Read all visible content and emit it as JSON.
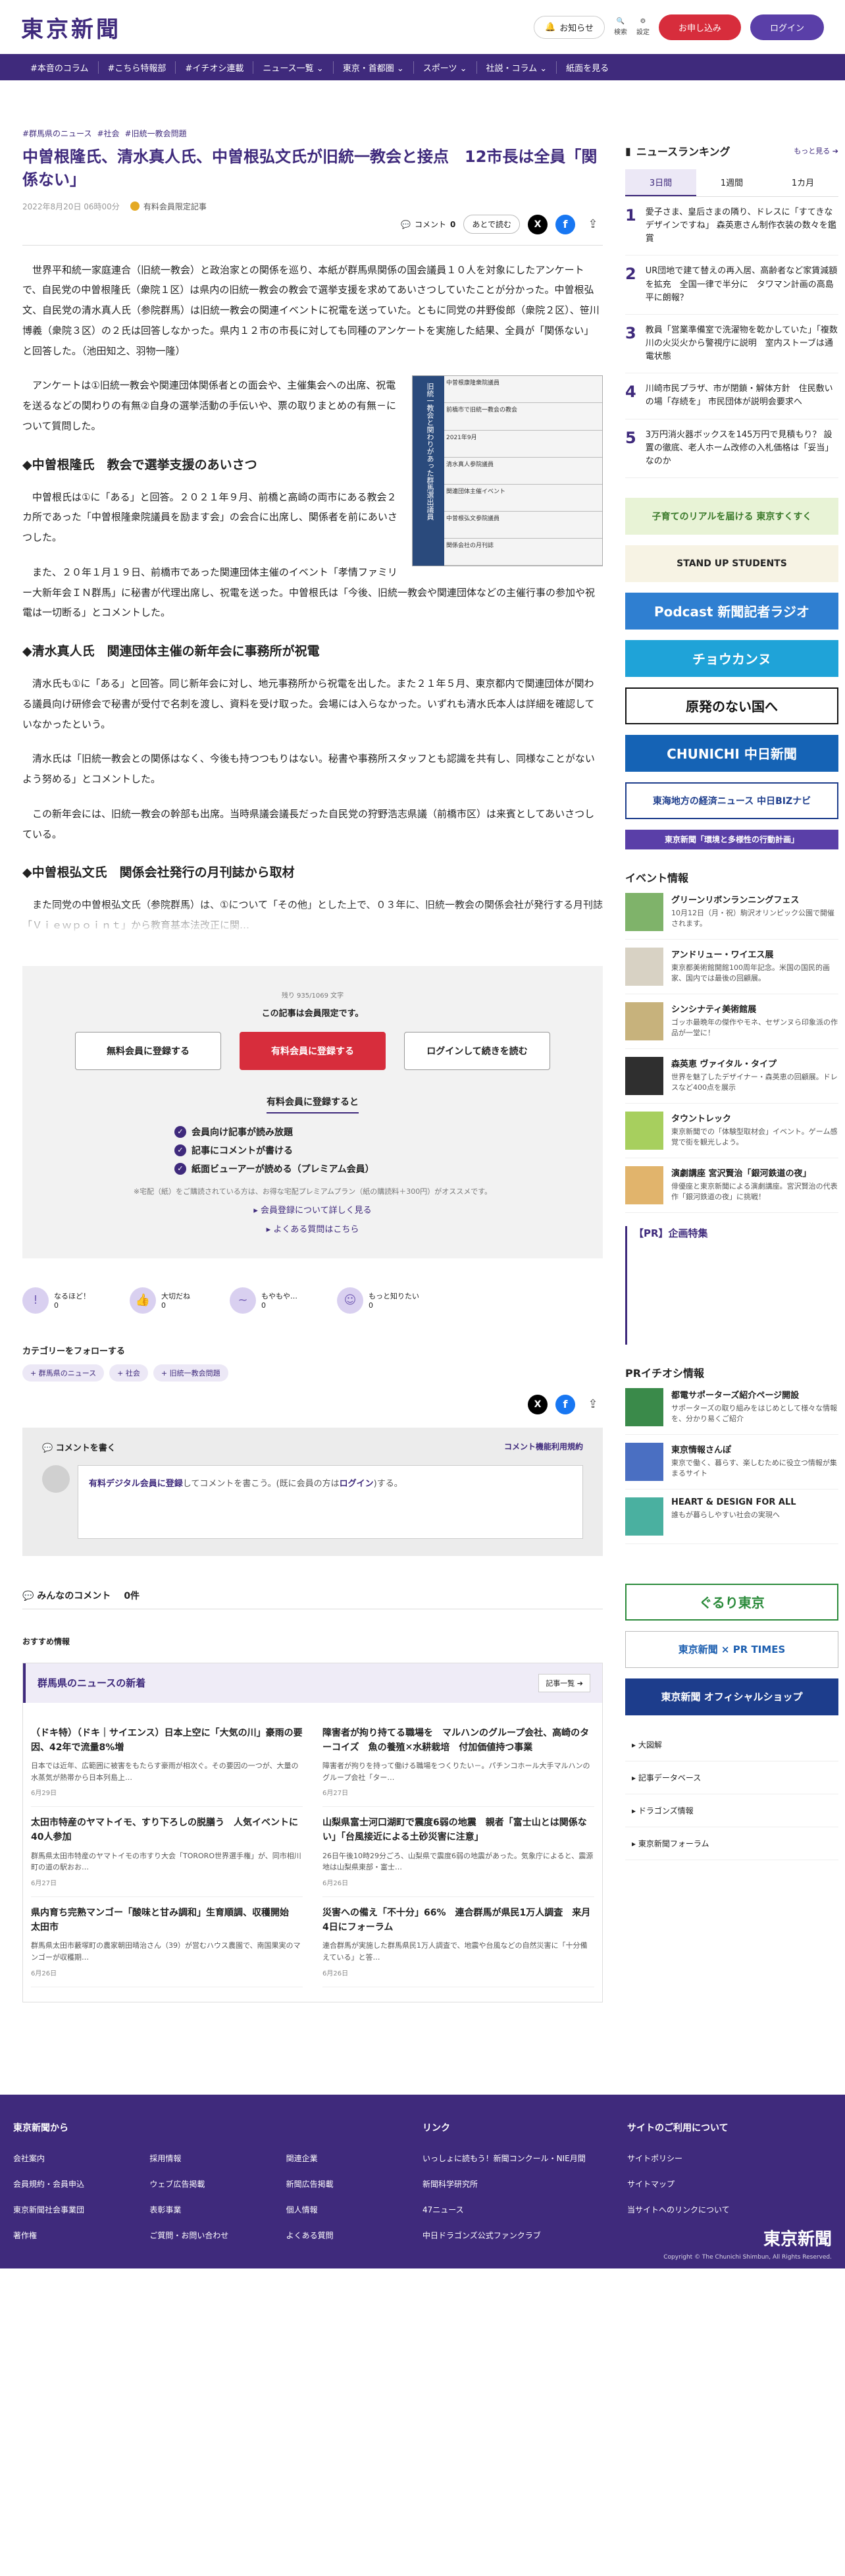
{
  "header": {
    "logo": "東京新聞",
    "notify": "お知らせ",
    "search": "検索",
    "settings": "設定",
    "register": "お申し込み",
    "login": "ログイン"
  },
  "nav": [
    "#本音のコラム",
    "#こちら特報部",
    "#イチオシ連載",
    "ニュース一覧 ⌄",
    "東京・首都圏 ⌄",
    "スポーツ ⌄",
    "社説・コラム ⌄",
    "紙面を見る"
  ],
  "article": {
    "tags": [
      "#群馬県のニュース",
      "#社会",
      "#旧統一教会問題"
    ],
    "title": "中曽根隆氏、清水真人氏、中曽根弘文氏が旧統一教会と接点　12市長は全員「関係ない」",
    "date": "2022年8月20日 06時00分",
    "limited": "有料会員限定記事",
    "comment_label": "コメント",
    "comment_count": "0",
    "later": "あとで読む",
    "paragraphs": [
      "世界平和統一家庭連合（旧統一教会）と政治家との関係を巡り、本紙が群馬県関係の国会議員１０人を対象にしたアンケートで、自民党の中曽根隆氏（衆院１区）は県内の旧統一教会の教会で選挙支援を求めてあいさつしていたことが分かった。中曽根弘文、自民党の清水真人氏（参院群馬）は旧統一教会の関連イベントに祝電を送っていた。ともに同党の井野俊郎（衆院２区）、笹川博義（衆院３区）の２氏は回答しなかった。県内１２市の市長に対しても同種のアンケートを実施した結果、全員が「関係ない」と回答した。（池田知之、羽物一隆）",
      "アンケートは①旧統一教会や関連団体関係者との面会や、主催集会への出席、祝電を送るなどの関わりの有無②自身の選挙活動の手伝いや、票の取りまとめの有無－について質問した。"
    ],
    "h1": "◆中曽根隆氏　教会で選挙支援のあいさつ",
    "p2": [
      "中曽根氏は①に「ある」と回答。２０２１年９月、前橋と高崎の両市にある教会２カ所であった「中曽根隆衆院議員を励ます会」の会合に出席し、関係者を前にあいさつした。",
      "また、２０年１月１９日、前橋市であった関連団体主催のイベント「孝情ファミリー大新年会ＩＮ群馬」に秘書が代理出席し、祝電を送った。中曽根氏は「今後、旧統一教会や関連団体などの主催行事の参加や祝電は一切断る」とコメントした。"
    ],
    "h2": "◆清水真人氏　関連団体主催の新年会に事務所が祝電",
    "p3": [
      "清水氏も①に「ある」と回答。同じ新年会に対し、地元事務所から祝電を出した。また２１年５月、東京都内で関連団体が関わる議員向け研修会で秘書が受付で名刺を渡し、資料を受け取った。会場には入らなかった。いずれも清水氏本人は詳細を確認していなかったという。",
      "清水氏は「旧統一教会との関係はなく、今後も持つつもりはない。秘書や事務所スタッフとも認識を共有し、同様なことがないよう努める」とコメントした。",
      "この新年会には、旧統一教会の幹部も出席。当時県議会議長だった自民党の狩野浩志県議（前橋市区）は来賓としてあいさつしている。"
    ],
    "h3": "◆中曽根弘文氏　関係会社発行の月刊誌から取材",
    "p4": "また同党の中曽根弘文氏（参院群馬）は、①について「その他」とした上で、０３年に、旧統一教会の関係会社が発行する月刊誌「Ｖｉｅｗｐｏｉｎｔ」から教育基本法改正に関…",
    "fig_caption": "旧統一教会と関わりがあった群馬選出議員",
    "fig_rows": [
      "中曽根康隆衆院議員",
      "前橋市で旧統一教会の教会",
      "2021年9月",
      "清水真人参院議員",
      "関連団体主催イベント",
      "中曽根弘文参院議員",
      "関係会社の月刊誌"
    ]
  },
  "paywall": {
    "remaining": "残り 935/1069 文字",
    "lead": "この記事は会員限定です。",
    "free": "無料会員に登録する",
    "paid": "有料会員に登録する",
    "login": "ログインして続きを読む",
    "reg_title": "有料会員に登録すると",
    "benefits": [
      "会員向け記事が読み放題",
      "記事にコメントが書ける",
      "紙面ビューアーが読める（プレミアム会員）"
    ],
    "note": "※宅配（紙）をご購読されている方は、お得な宅配プレミアムプラン（紙の購読料＋300円）がオススメです。",
    "more1": "会員登録について詳しく見る",
    "more2": "よくある質問はこちら"
  },
  "reactions": [
    {
      "label": "なるほど！",
      "n": "0"
    },
    {
      "label": "大切だね",
      "n": "0"
    },
    {
      "label": "もやもや…",
      "n": "0"
    },
    {
      "label": "もっと知りたい",
      "n": "0"
    }
  ],
  "follow": {
    "title": "カテゴリーをフォローする",
    "cats": [
      "+ 群馬県のニュース",
      "+ 社会",
      "+ 旧統一教会問題"
    ]
  },
  "comments": {
    "title": "コメントを書く",
    "rules": "コメント機能利用規約",
    "pre": "有料デジタル会員に登録",
    "mid": "してコメントを書こう。(既に会員の方は",
    "login": "ログイン",
    "post": ")する。",
    "all": "みんなのコメント",
    "count": "0件"
  },
  "recommend": "おすすめ情報",
  "local": {
    "title": "群馬県のニュースの新着",
    "more": "記事一覧 ➔",
    "items": [
      {
        "h": "（ドキ特）（ドキ｜サイエンス）日本上空に「大気の川」豪雨の要因、42年で流量8%増",
        "p": "日本では近年、広範囲に被害をもたらす豪雨が相次ぐ。その要因の一つが、大量の水蒸気が熱帯から日本列島上…",
        "t": "6月29日"
      },
      {
        "h": "障害者が拘り持てる職場を　マルハンのグループ会社、高崎のターコイズ　魚の養殖✕水耕栽培　付加価値持つ事業",
        "p": "障害者が拘りを持って働ける職場をつくりたい－。パチンコホール大手マルハンのグループ会社「ター…",
        "t": "6月27日"
      },
      {
        "h": "太田市特産のヤマトイモ、すり下ろしの脱膳う　人気イベントに40人参加",
        "p": "群馬県太田市特産のヤマトイモの市すり大会「TORORO世界選手権」が、同市相川町の道の駅おお…",
        "t": "6月27日"
      },
      {
        "h": "山梨県富士河口湖町で震度6弱の地震　親者「富士山とは関係ない」「台風接近による土砂災害に注意」",
        "p": "26日午後10時29分ごろ、山梨県で震度6弱の地震があった。気象庁によると、震源地は山梨県東部・富士…",
        "t": "6月26日"
      },
      {
        "h": "県内育ち完熟マンゴー「酸味と甘み調和」生育順調、収穫開始　太田市",
        "p": "群馬県太田市藪塚町の農家朝田晴治さん（39）が営むハウス農園で、南国果実のマンゴーが収穫期…",
        "t": "6月26日"
      },
      {
        "h": "災害への備え「不十分」66%　連合群馬が県民1万人調査　来月4日にフォーラム",
        "p": "連合群馬が実施した群馬県民1万人調査で、地震や台風などの自然災害に「十分備えている」と答…",
        "t": "6月26日"
      }
    ]
  },
  "ranking": {
    "title": "ニュースランキング",
    "more": "もっと見る ➔",
    "tabs": [
      "3日間",
      "1週間",
      "1カ月"
    ],
    "items": [
      "愛子さま、皇后さまの隣り、ドレスに「すてきなデザインですね」 森英恵さん制作衣装の数々を鑑賞",
      "UR団地で建て替えの再入居、高齢者など家賃減額を拡充　全国一律で半分に　タワマン計画の高島平に朗報？",
      "教員「営業準備室で洗濯物を乾かしていた」「複数川の火災火から警視庁に説明　室内ストーブは通電状態",
      "川崎市民プラザ、市が閉鎖・解体方針　住民敷いの場「存続を」 市民団体が説明会要求へ",
      "3万円消火器ボックスを145万円で見積もり？ 設置の徹底、老人ホーム改修の入札価格は「妥当」なのか"
    ]
  },
  "banners": [
    "子育てのリアルを届ける 東京すくすく",
    "STAND UP STUDENTS",
    "Podcast 新聞記者ラジオ",
    "チョウカンヌ",
    "原発のない国へ",
    "CHUNICHI 中日新聞",
    "東海地方の経済ニュース 中日BIZナビ",
    "東京新聞「環境と多様性の行動計画」"
  ],
  "events": {
    "title": "イベント情報",
    "items": [
      {
        "h": "グリーンリボンランニングフェス",
        "p": "10月12日（月・祝）駒沢オリンピック公園で開催されます。"
      },
      {
        "h": "アンドリュー・ワイエス展",
        "p": "東京都美術館開館100周年記念。米国の国民的画家、国内では最後の回顧展。"
      },
      {
        "h": "シンシナティ美術館展",
        "p": "ゴッホ最晩年の傑作やモネ、セザンヌら印象派の作品が一堂に！"
      },
      {
        "h": "森英恵 ヴァイタル・タイプ",
        "p": "世界を魅了したデザイナー・森英恵の回顧展。ドレスなど400点を展示"
      },
      {
        "h": "タウントレック",
        "p": "東京新聞での「体験型取材会」イベント。ゲーム感覚で街を観光しよう。"
      },
      {
        "h": "演劇講座 宮沢賢治「銀河鉄道の夜」",
        "p": "俳優座と東京新聞による演劇講座。宮沢賢治の代表作「銀河鉄道の夜」に挑戦！"
      }
    ]
  },
  "pr_title": "【PR】企画特集",
  "pr2": {
    "title": "PRイチオシ情報",
    "items": [
      {
        "h": "都電サポーターズ紹介ページ開設",
        "p": "サポーターズの取り組みをはじめとして様々な情報を、分かり易くご紹介"
      },
      {
        "h": "東京情報さんぽ",
        "p": "東京で働く、暮らす、楽しむために役立つ情報が集まるサイト"
      },
      {
        "h": "HEART & DESIGN FOR ALL",
        "p": "誰もが暮らしやすい社会の実現へ"
      }
    ]
  },
  "banners2": [
    "ぐるり東京",
    "東京新聞 × PR TIMES",
    "東京新聞 オフィシャルショップ"
  ],
  "sidelinks": [
    "大図解",
    "記事データベース",
    "ドラゴンズ情報",
    "東京新聞フォーラム"
  ],
  "footer": {
    "c1": "東京新聞から",
    "l1": [
      "会社案内",
      "採用情報",
      "関連企業",
      "会員規約・会員申込",
      "ウェブ広告掲載",
      "新聞広告掲載",
      "東京新聞社会事業団",
      "表彰事業",
      "個人情報",
      "著作権",
      "ご質問・お問い合わせ",
      "よくある質問"
    ],
    "c2": "リンク",
    "l2": [
      "いっしょに読もう！新聞コンクール・NIE月間",
      "新聞科学研究所",
      "47ニュース",
      "中日ドラゴンズ公式ファンクラブ"
    ],
    "c3": "サイトのご利用について",
    "l3": [
      "サイトポリシー",
      "サイトマップ",
      "当サイトへのリンクについて"
    ],
    "logo": "東京新聞",
    "copy": "Copyright © The Chunichi Shimbun, All Rights Reserved."
  }
}
